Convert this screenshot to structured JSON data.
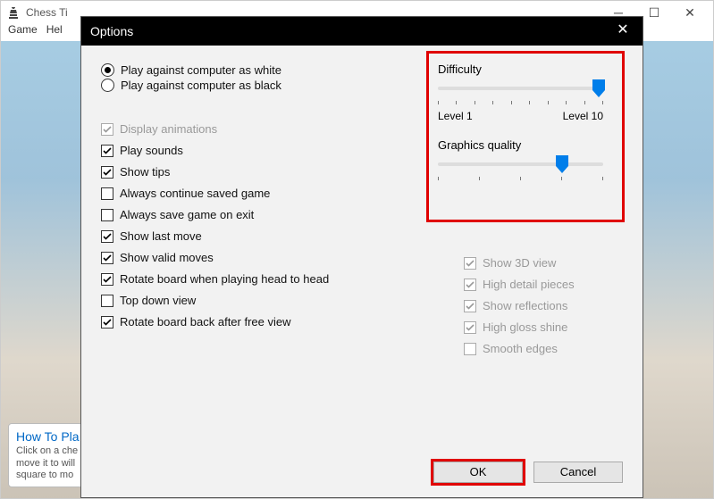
{
  "main_window": {
    "title": "Chess Ti",
    "menu": {
      "game": "Game",
      "help": "Hel"
    },
    "howto": {
      "title": "How To Pla",
      "body": "Click on a che\nmove it to will\nsquare to mo"
    }
  },
  "dialog": {
    "title": "Options",
    "radios": {
      "white": "Play against computer as white",
      "black": "Play against computer as black"
    },
    "checks": {
      "animations": "Display animations",
      "sounds": "Play sounds",
      "tips": "Show tips",
      "continue_saved": "Always continue saved game",
      "save_on_exit": "Always save game on exit",
      "last_move": "Show last move",
      "valid_moves": "Show valid moves",
      "rotate_h2h": "Rotate board when playing head to head",
      "top_down": "Top down view",
      "rotate_back": "Rotate board back after free view"
    },
    "sliders": {
      "difficulty": {
        "title": "Difficulty",
        "min_label": "Level 1",
        "max_label": "Level 10",
        "value": 10,
        "max": 10
      },
      "graphics": {
        "title": "Graphics quality",
        "value": 4,
        "max": 5
      }
    },
    "right_checks": {
      "show_3d": "Show 3D view",
      "high_detail": "High detail pieces",
      "reflections": "Show reflections",
      "gloss": "High gloss shine",
      "smooth": "Smooth edges"
    },
    "buttons": {
      "ok": "OK",
      "cancel": "Cancel"
    }
  },
  "chart_data": {
    "type": "table",
    "title": "Options dialog state",
    "radio_selected": "white",
    "checkboxes": [
      {
        "name": "Display animations",
        "checked": true,
        "disabled": true
      },
      {
        "name": "Play sounds",
        "checked": true,
        "disabled": false
      },
      {
        "name": "Show tips",
        "checked": true,
        "disabled": false
      },
      {
        "name": "Always continue saved game",
        "checked": false,
        "disabled": false
      },
      {
        "name": "Always save game on exit",
        "checked": false,
        "disabled": false
      },
      {
        "name": "Show last move",
        "checked": true,
        "disabled": false
      },
      {
        "name": "Show valid moves",
        "checked": true,
        "disabled": false
      },
      {
        "name": "Rotate board when playing head to head",
        "checked": true,
        "disabled": false
      },
      {
        "name": "Top down view",
        "checked": false,
        "disabled": false
      },
      {
        "name": "Rotate board back after free view",
        "checked": true,
        "disabled": false
      },
      {
        "name": "Show 3D view",
        "checked": true,
        "disabled": true
      },
      {
        "name": "High detail pieces",
        "checked": true,
        "disabled": true
      },
      {
        "name": "Show reflections",
        "checked": true,
        "disabled": true
      },
      {
        "name": "High gloss shine",
        "checked": true,
        "disabled": true
      },
      {
        "name": "Smooth edges",
        "checked": false,
        "disabled": true
      }
    ],
    "sliders": [
      {
        "name": "Difficulty",
        "value": 10,
        "min": 1,
        "max": 10
      },
      {
        "name": "Graphics quality",
        "value": 4,
        "min": 1,
        "max": 5
      }
    ]
  }
}
